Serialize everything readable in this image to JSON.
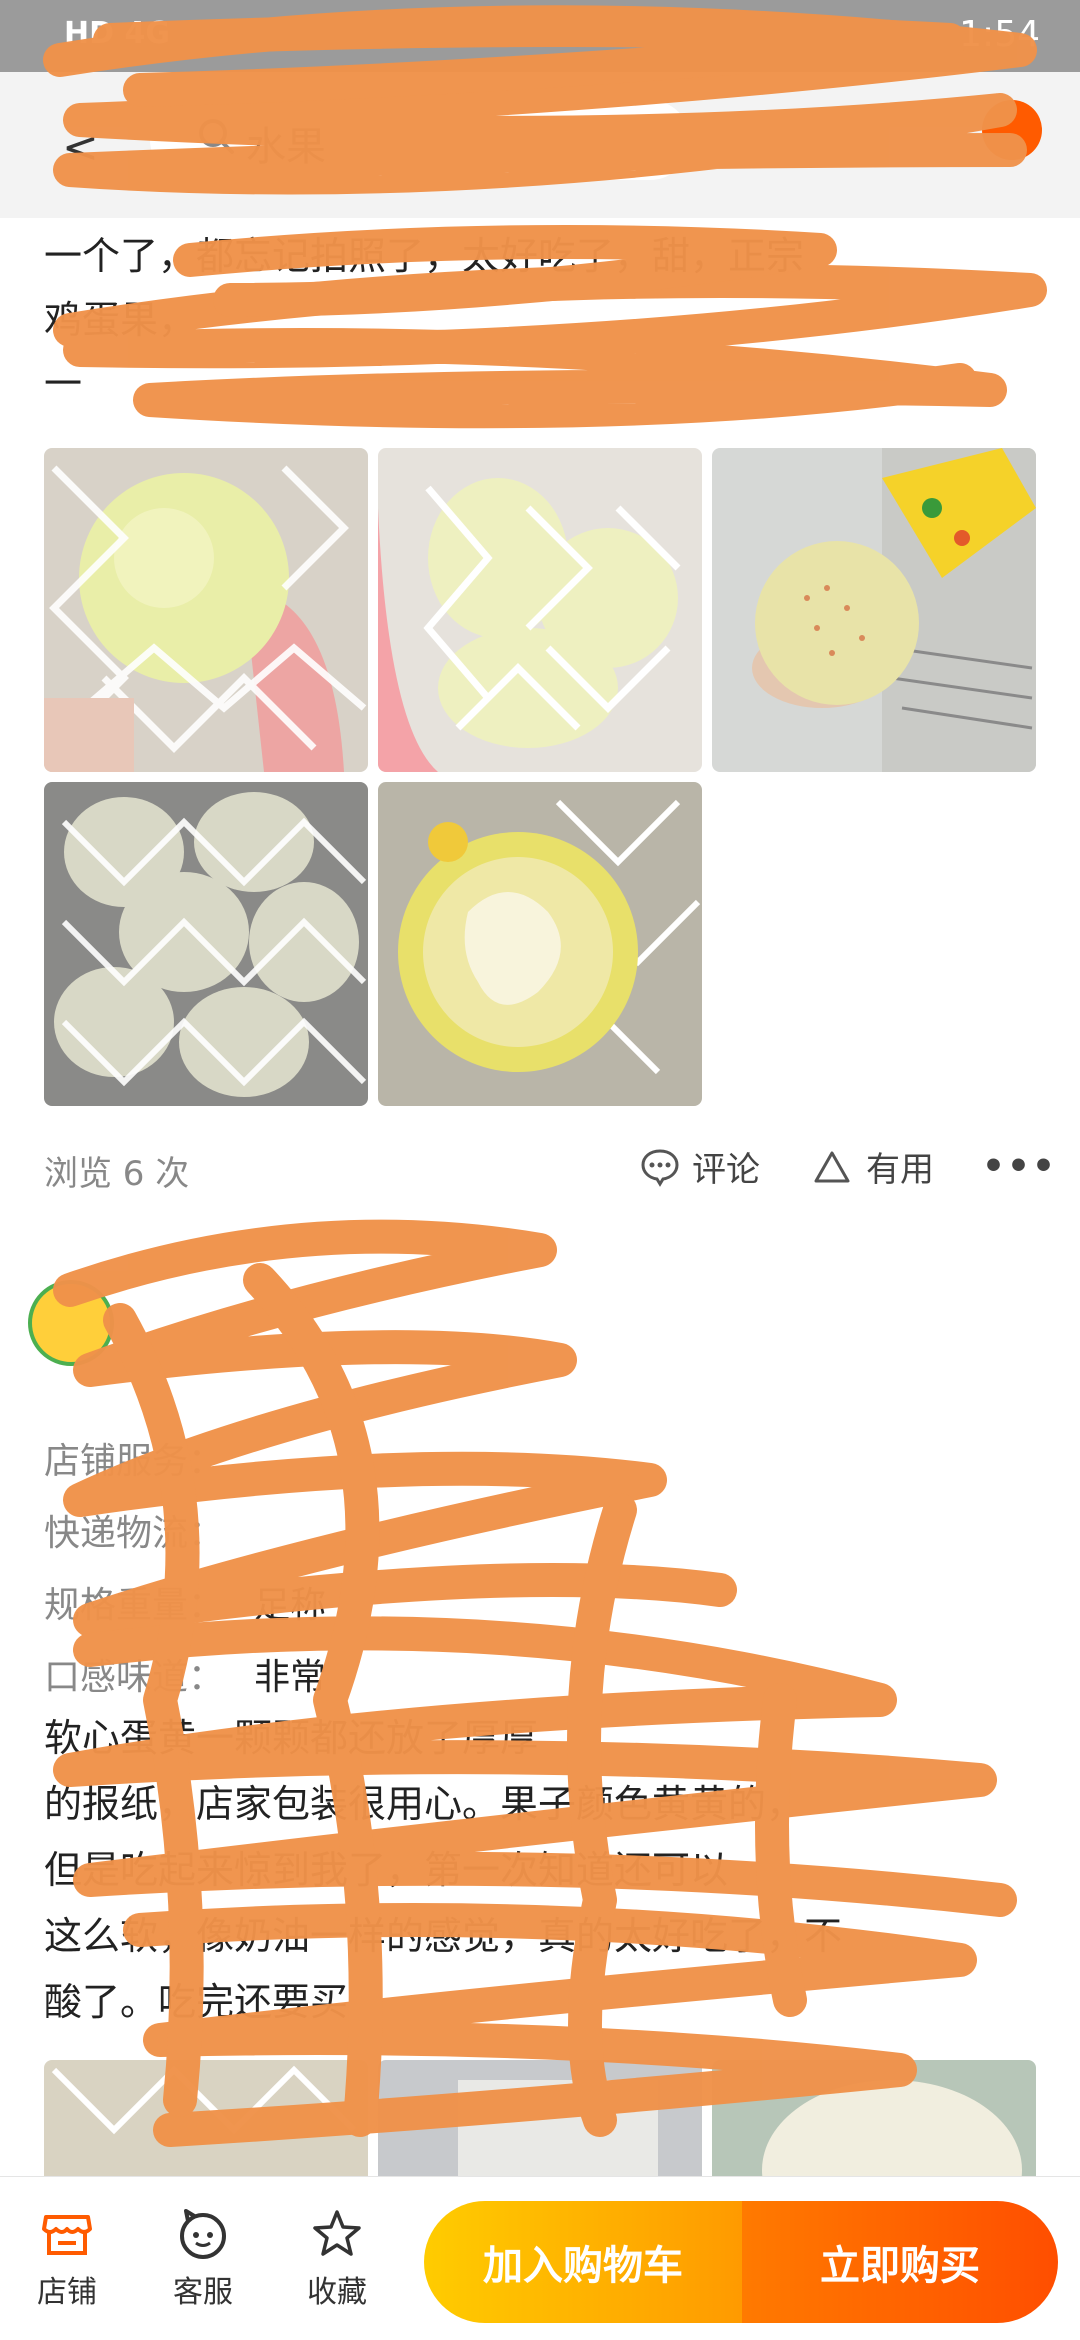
{
  "status_bar": {
    "network": "HD 4G",
    "time": "1:54"
  },
  "header": {
    "search_text": "水果"
  },
  "review1": {
    "lines": [
      "一个了，都忘记拍照了，太好吃了，甜，正宗",
      "鸡蛋果，",
      "一"
    ],
    "views": "浏览 6 次",
    "comment_label": "评论",
    "useful_label": "有用",
    "more": "•••"
  },
  "review2": {
    "attrs": [
      {
        "label": "店铺服务：",
        "value": ""
      },
      {
        "label": "快递物流：",
        "value": ""
      },
      {
        "label": "规格重量：",
        "value": "足称"
      },
      {
        "label": "口感味道：",
        "value": "非常"
      }
    ],
    "lines": [
      "软心蛋黄一颗颗都还放了厚厚",
      "的报纸，店家包装很用心。果子颜色黄黄的，",
      "但是吃起来惊到我了，第一次知道还可以",
      "这么软，像奶油一样的感觉，真的太好吃了，不",
      "酸了。吃完还要买"
    ]
  },
  "bottom_bar": {
    "store_label": "店铺",
    "service_label": "客服",
    "favorite_label": "收藏",
    "cart_button": "加入购物车",
    "buy_button": "立即购买"
  },
  "colors": {
    "accent": "#ff5b00",
    "scribble": "#f0924a",
    "cart_start": "#ffcc00",
    "buy_end": "#ff4e00"
  },
  "icons": [
    "back-icon",
    "search-icon",
    "comment-icon",
    "like-icon",
    "more-icon",
    "store-icon",
    "service-icon",
    "favorite-icon"
  ]
}
